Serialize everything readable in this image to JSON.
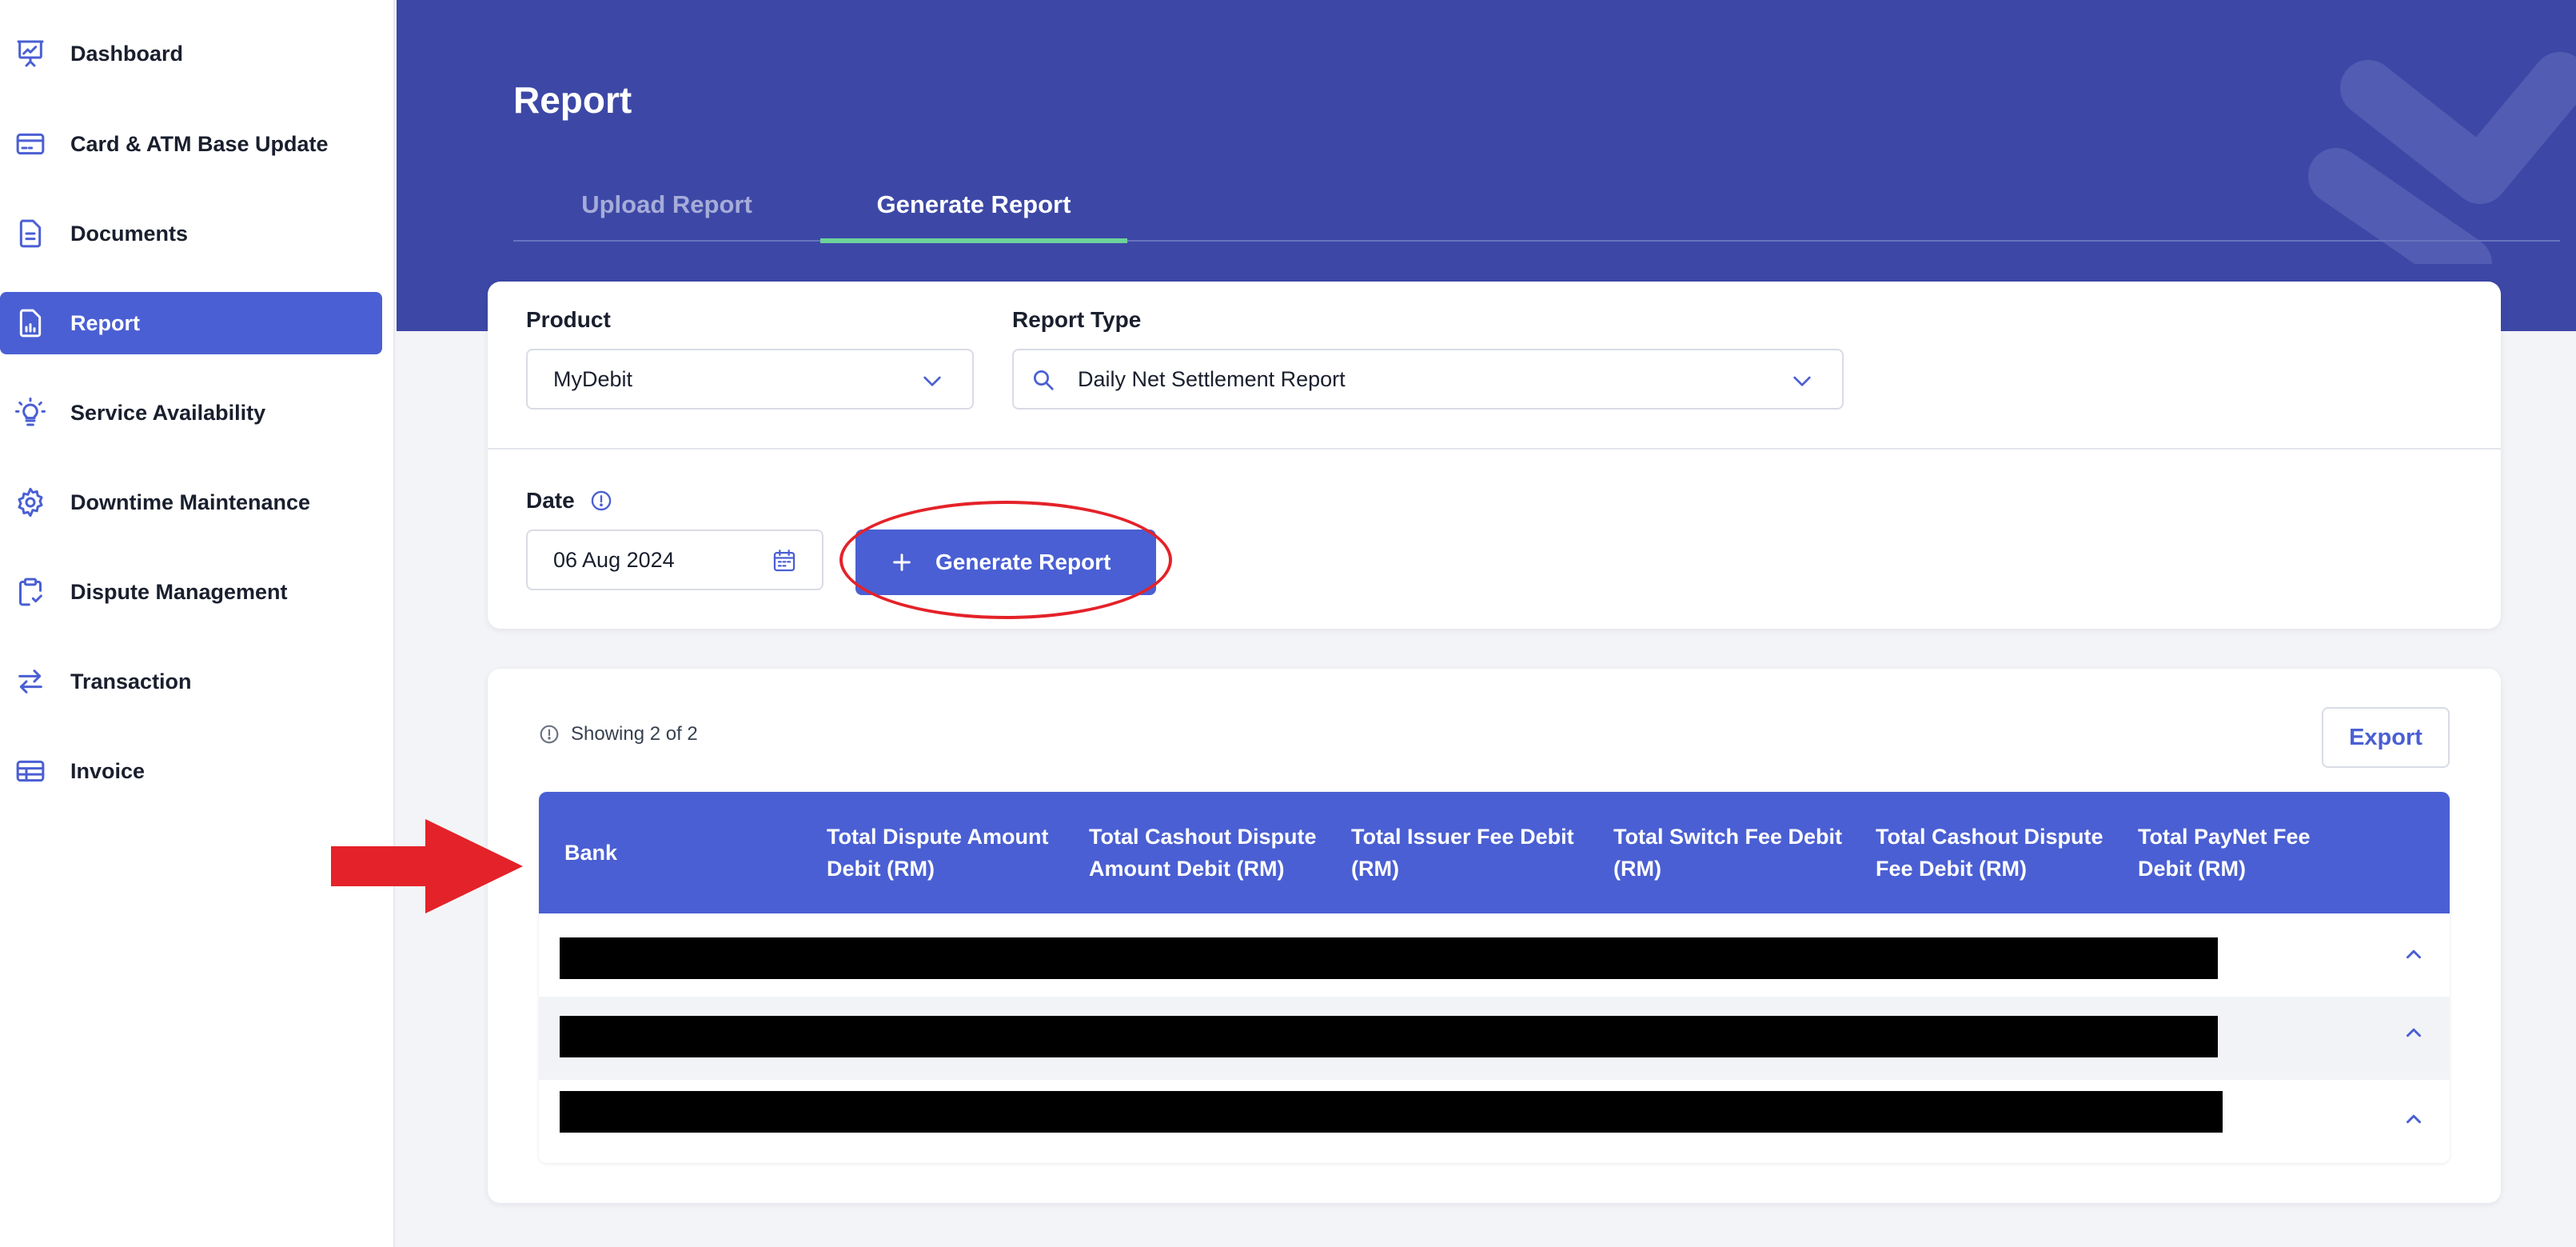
{
  "sidebar": {
    "items": [
      {
        "label": "Dashboard",
        "icon": "presentation-chart-icon"
      },
      {
        "label": "Card & ATM Base Update",
        "icon": "credit-card-icon"
      },
      {
        "label": "Documents",
        "icon": "document-icon"
      },
      {
        "label": "Report",
        "icon": "report-chart-icon",
        "active": true
      },
      {
        "label": "Service Availability",
        "icon": "lightbulb-icon"
      },
      {
        "label": "Downtime Maintenance",
        "icon": "gear-icon"
      },
      {
        "label": "Dispute Management",
        "icon": "clipboard-icon"
      },
      {
        "label": "Transaction",
        "icon": "arrows-exchange-icon"
      },
      {
        "label": "Invoice",
        "icon": "invoice-table-icon"
      }
    ]
  },
  "header": {
    "title": "Report",
    "tabs": [
      {
        "label": "Upload Report",
        "active": false
      },
      {
        "label": "Generate Report",
        "active": true
      }
    ]
  },
  "filters": {
    "product": {
      "label": "Product",
      "value": "MyDebit"
    },
    "report_type": {
      "label": "Report Type",
      "value": "Daily Net Settlement Report"
    },
    "date": {
      "label": "Date",
      "value": "06 Aug 2024"
    },
    "generate_button": "Generate Report"
  },
  "results": {
    "showing": "Showing 2 of 2",
    "export_label": "Export",
    "columns": [
      "Bank",
      "Total Dispute Amount Debit (RM)",
      "Total Cashout Dispute Amount Debit (RM)",
      "Total Issuer Fee Debit (RM)",
      "Total Switch Fee Debit (RM)",
      "Total Cashout Dispute Fee Debit (RM)",
      "Total PayNet Fee Debit (RM)"
    ]
  },
  "colors": {
    "accent": "#4a5fd3",
    "banner": "#3d48a6",
    "active_tab_underline": "#6dd39a",
    "annotation_red": "#e42229"
  }
}
